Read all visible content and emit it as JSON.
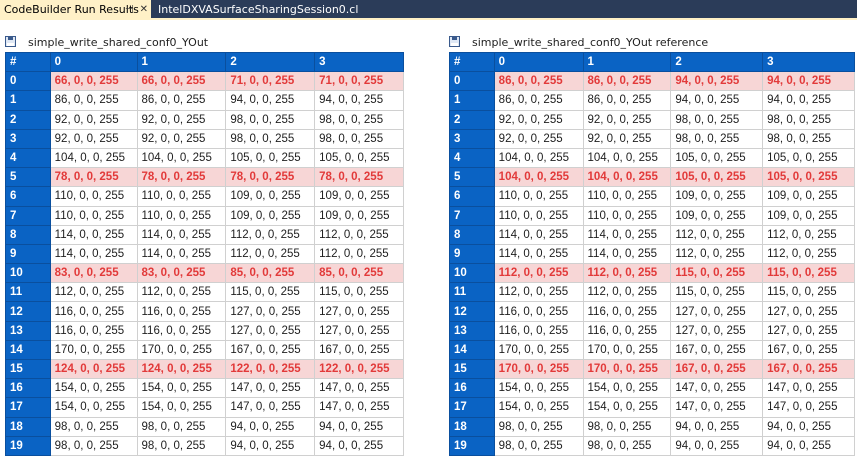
{
  "tabs": [
    {
      "label": "CodeBuilder Run Results",
      "active": true
    },
    {
      "label": "IntelDXVASurfaceSharingSession0.cl",
      "active": false
    }
  ],
  "tab_icons": [
    "pin-icon",
    "close-icon"
  ],
  "colors": {
    "tabbar": "#2b3c59",
    "active_tab": "#fff1c7",
    "header_blue": "#0a63c4",
    "highlight_row_bg": "#f7d6d6",
    "highlight_text": "#e23a3a"
  },
  "panels": [
    {
      "title": "simple_write_shared_conf0_YOut",
      "columns": [
        "#",
        "0",
        "1",
        "2",
        "3"
      ],
      "rows": [
        {
          "idx": "0",
          "cells": [
            "66, 0, 0, 255",
            "66, 0, 0, 255",
            "71, 0, 0, 255",
            "71, 0, 0, 255"
          ],
          "highlight": true
        },
        {
          "idx": "1",
          "cells": [
            "86, 0, 0, 255",
            "86, 0, 0, 255",
            "94, 0, 0, 255",
            "94, 0, 0, 255"
          ],
          "highlight": false
        },
        {
          "idx": "2",
          "cells": [
            "92, 0, 0, 255",
            "92, 0, 0, 255",
            "98, 0, 0, 255",
            "98, 0, 0, 255"
          ],
          "highlight": false
        },
        {
          "idx": "3",
          "cells": [
            "92, 0, 0, 255",
            "92, 0, 0, 255",
            "98, 0, 0, 255",
            "98, 0, 0, 255"
          ],
          "highlight": false
        },
        {
          "idx": "4",
          "cells": [
            "104, 0, 0, 255",
            "104, 0, 0, 255",
            "105, 0, 0, 255",
            "105, 0, 0, 255"
          ],
          "highlight": false
        },
        {
          "idx": "5",
          "cells": [
            "78, 0, 0, 255",
            "78, 0, 0, 255",
            "78, 0, 0, 255",
            "78, 0, 0, 255"
          ],
          "highlight": true
        },
        {
          "idx": "6",
          "cells": [
            "110, 0, 0, 255",
            "110, 0, 0, 255",
            "109, 0, 0, 255",
            "109, 0, 0, 255"
          ],
          "highlight": false
        },
        {
          "idx": "7",
          "cells": [
            "110, 0, 0, 255",
            "110, 0, 0, 255",
            "109, 0, 0, 255",
            "109, 0, 0, 255"
          ],
          "highlight": false
        },
        {
          "idx": "8",
          "cells": [
            "114, 0, 0, 255",
            "114, 0, 0, 255",
            "112, 0, 0, 255",
            "112, 0, 0, 255"
          ],
          "highlight": false
        },
        {
          "idx": "9",
          "cells": [
            "114, 0, 0, 255",
            "114, 0, 0, 255",
            "112, 0, 0, 255",
            "112, 0, 0, 255"
          ],
          "highlight": false
        },
        {
          "idx": "10",
          "cells": [
            "83, 0, 0, 255",
            "83, 0, 0, 255",
            "85, 0, 0, 255",
            "85, 0, 0, 255"
          ],
          "highlight": true
        },
        {
          "idx": "11",
          "cells": [
            "112, 0, 0, 255",
            "112, 0, 0, 255",
            "115, 0, 0, 255",
            "115, 0, 0, 255"
          ],
          "highlight": false
        },
        {
          "idx": "12",
          "cells": [
            "116, 0, 0, 255",
            "116, 0, 0, 255",
            "127, 0, 0, 255",
            "127, 0, 0, 255"
          ],
          "highlight": false
        },
        {
          "idx": "13",
          "cells": [
            "116, 0, 0, 255",
            "116, 0, 0, 255",
            "127, 0, 0, 255",
            "127, 0, 0, 255"
          ],
          "highlight": false
        },
        {
          "idx": "14",
          "cells": [
            "170, 0, 0, 255",
            "170, 0, 0, 255",
            "167, 0, 0, 255",
            "167, 0, 0, 255"
          ],
          "highlight": false
        },
        {
          "idx": "15",
          "cells": [
            "124, 0, 0, 255",
            "124, 0, 0, 255",
            "122, 0, 0, 255",
            "122, 0, 0, 255"
          ],
          "highlight": true
        },
        {
          "idx": "16",
          "cells": [
            "154, 0, 0, 255",
            "154, 0, 0, 255",
            "147, 0, 0, 255",
            "147, 0, 0, 255"
          ],
          "highlight": false
        },
        {
          "idx": "17",
          "cells": [
            "154, 0, 0, 255",
            "154, 0, 0, 255",
            "147, 0, 0, 255",
            "147, 0, 0, 255"
          ],
          "highlight": false
        },
        {
          "idx": "18",
          "cells": [
            "98, 0, 0, 255",
            "98, 0, 0, 255",
            "94, 0, 0, 255",
            "94, 0, 0, 255"
          ],
          "highlight": false
        },
        {
          "idx": "19",
          "cells": [
            "98, 0, 0, 255",
            "98, 0, 0, 255",
            "94, 0, 0, 255",
            "94, 0, 0, 255"
          ],
          "highlight": false
        }
      ]
    },
    {
      "title": "simple_write_shared_conf0_YOut reference",
      "columns": [
        "#",
        "0",
        "1",
        "2",
        "3"
      ],
      "rows": [
        {
          "idx": "0",
          "cells": [
            "86, 0, 0, 255",
            "86, 0, 0, 255",
            "94, 0, 0, 255",
            "94, 0, 0, 255"
          ],
          "highlight": true
        },
        {
          "idx": "1",
          "cells": [
            "86, 0, 0, 255",
            "86, 0, 0, 255",
            "94, 0, 0, 255",
            "94, 0, 0, 255"
          ],
          "highlight": false
        },
        {
          "idx": "2",
          "cells": [
            "92, 0, 0, 255",
            "92, 0, 0, 255",
            "98, 0, 0, 255",
            "98, 0, 0, 255"
          ],
          "highlight": false
        },
        {
          "idx": "3",
          "cells": [
            "92, 0, 0, 255",
            "92, 0, 0, 255",
            "98, 0, 0, 255",
            "98, 0, 0, 255"
          ],
          "highlight": false
        },
        {
          "idx": "4",
          "cells": [
            "104, 0, 0, 255",
            "104, 0, 0, 255",
            "105, 0, 0, 255",
            "105, 0, 0, 255"
          ],
          "highlight": false
        },
        {
          "idx": "5",
          "cells": [
            "104, 0, 0, 255",
            "104, 0, 0, 255",
            "105, 0, 0, 255",
            "105, 0, 0, 255"
          ],
          "highlight": true
        },
        {
          "idx": "6",
          "cells": [
            "110, 0, 0, 255",
            "110, 0, 0, 255",
            "109, 0, 0, 255",
            "109, 0, 0, 255"
          ],
          "highlight": false
        },
        {
          "idx": "7",
          "cells": [
            "110, 0, 0, 255",
            "110, 0, 0, 255",
            "109, 0, 0, 255",
            "109, 0, 0, 255"
          ],
          "highlight": false
        },
        {
          "idx": "8",
          "cells": [
            "114, 0, 0, 255",
            "114, 0, 0, 255",
            "112, 0, 0, 255",
            "112, 0, 0, 255"
          ],
          "highlight": false
        },
        {
          "idx": "9",
          "cells": [
            "114, 0, 0, 255",
            "114, 0, 0, 255",
            "112, 0, 0, 255",
            "112, 0, 0, 255"
          ],
          "highlight": false
        },
        {
          "idx": "10",
          "cells": [
            "112, 0, 0, 255",
            "112, 0, 0, 255",
            "115, 0, 0, 255",
            "115, 0, 0, 255"
          ],
          "highlight": true
        },
        {
          "idx": "11",
          "cells": [
            "112, 0, 0, 255",
            "112, 0, 0, 255",
            "115, 0, 0, 255",
            "115, 0, 0, 255"
          ],
          "highlight": false
        },
        {
          "idx": "12",
          "cells": [
            "116, 0, 0, 255",
            "116, 0, 0, 255",
            "127, 0, 0, 255",
            "127, 0, 0, 255"
          ],
          "highlight": false
        },
        {
          "idx": "13",
          "cells": [
            "116, 0, 0, 255",
            "116, 0, 0, 255",
            "127, 0, 0, 255",
            "127, 0, 0, 255"
          ],
          "highlight": false
        },
        {
          "idx": "14",
          "cells": [
            "170, 0, 0, 255",
            "170, 0, 0, 255",
            "167, 0, 0, 255",
            "167, 0, 0, 255"
          ],
          "highlight": false
        },
        {
          "idx": "15",
          "cells": [
            "170, 0, 0, 255",
            "170, 0, 0, 255",
            "167, 0, 0, 255",
            "167, 0, 0, 255"
          ],
          "highlight": true
        },
        {
          "idx": "16",
          "cells": [
            "154, 0, 0, 255",
            "154, 0, 0, 255",
            "147, 0, 0, 255",
            "147, 0, 0, 255"
          ],
          "highlight": false
        },
        {
          "idx": "17",
          "cells": [
            "154, 0, 0, 255",
            "154, 0, 0, 255",
            "147, 0, 0, 255",
            "147, 0, 0, 255"
          ],
          "highlight": false
        },
        {
          "idx": "18",
          "cells": [
            "98, 0, 0, 255",
            "98, 0, 0, 255",
            "94, 0, 0, 255",
            "94, 0, 0, 255"
          ],
          "highlight": false
        },
        {
          "idx": "19",
          "cells": [
            "98, 0, 0, 255",
            "98, 0, 0, 255",
            "94, 0, 0, 255",
            "94, 0, 0, 255"
          ],
          "highlight": false
        }
      ]
    }
  ]
}
